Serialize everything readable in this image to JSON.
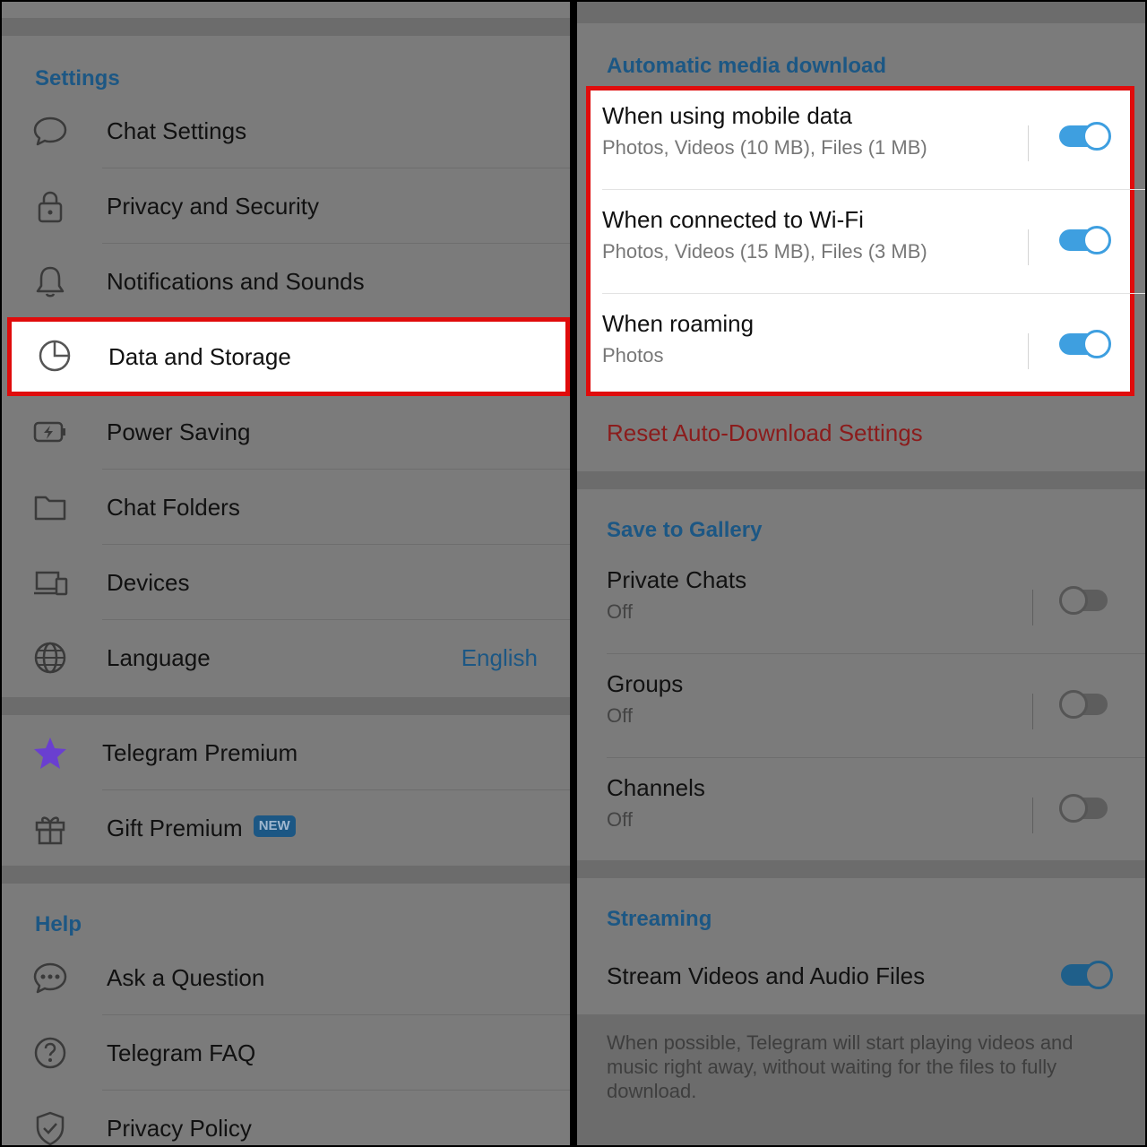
{
  "left": {
    "settings_header": "Settings",
    "settings_items": [
      {
        "label": "Chat Settings",
        "icon": "chat-bubble-icon"
      },
      {
        "label": "Privacy and Security",
        "icon": "lock-icon"
      },
      {
        "label": "Notifications and Sounds",
        "icon": "bell-icon"
      },
      {
        "label": "Data and Storage",
        "icon": "pie-chart-icon"
      },
      {
        "label": "Power Saving",
        "icon": "battery-icon"
      },
      {
        "label": "Chat Folders",
        "icon": "folder-icon"
      },
      {
        "label": "Devices",
        "icon": "devices-icon"
      },
      {
        "label": "Language",
        "icon": "globe-icon",
        "value": "English"
      }
    ],
    "premium_items": [
      {
        "label": "Telegram Premium",
        "icon": "star-icon"
      },
      {
        "label": "Gift Premium",
        "icon": "gift-icon",
        "badge": "NEW"
      }
    ],
    "help_header": "Help",
    "help_items": [
      {
        "label": "Ask a Question",
        "icon": "chat-dots-icon"
      },
      {
        "label": "Telegram FAQ",
        "icon": "question-icon"
      },
      {
        "label": "Privacy Policy",
        "icon": "shield-icon"
      }
    ]
  },
  "right": {
    "auto_download_header": "Automatic media download",
    "auto_download_items": [
      {
        "title": "When using mobile data",
        "subtitle": "Photos, Videos (10 MB), Files (1 MB)",
        "enabled": true
      },
      {
        "title": "When connected to Wi-Fi",
        "subtitle": "Photos, Videos (15 MB), Files (3 MB)",
        "enabled": true
      },
      {
        "title": "When roaming",
        "subtitle": "Photos",
        "enabled": true
      }
    ],
    "reset_label": "Reset Auto-Download Settings",
    "gallery_header": "Save to Gallery",
    "gallery_items": [
      {
        "title": "Private Chats",
        "subtitle": "Off",
        "enabled": false
      },
      {
        "title": "Groups",
        "subtitle": "Off",
        "enabled": false
      },
      {
        "title": "Channels",
        "subtitle": "Off",
        "enabled": false
      }
    ],
    "streaming_header": "Streaming",
    "streaming_item": {
      "title": "Stream Videos and Audio Files",
      "enabled": true
    },
    "streaming_note": "When possible, Telegram will start playing videos and music right away, without waiting for the files to fully download."
  },
  "colors": {
    "highlight_border": "#e00c0c",
    "accent_blue": "#1c5784",
    "toggle_on": "#3e9fe0",
    "reset_red": "#8b1c1c",
    "premium_star": "#6a3fd0"
  }
}
